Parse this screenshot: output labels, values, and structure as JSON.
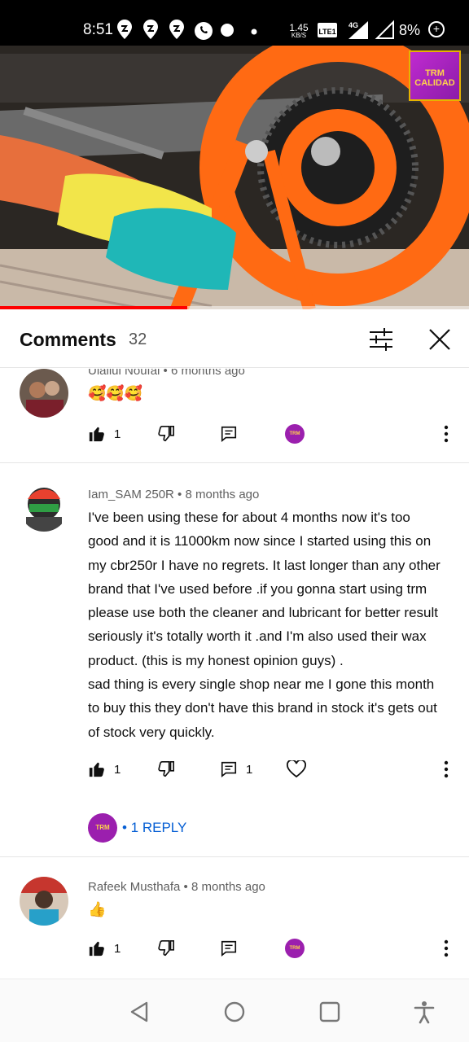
{
  "status_bar": {
    "time": "8:51",
    "speed_value": "1.45",
    "speed_unit": "KB/S",
    "network": "4G",
    "battery": "8%"
  },
  "video": {
    "channel_logo_text": "TRM CALIDAD",
    "progress_fraction": 0.4
  },
  "comments_header": {
    "title": "Comments",
    "count": "32"
  },
  "comments": [
    {
      "author": "Ulallul Noufal",
      "age": "6 months ago",
      "meta": "Ulallul Noufal • 6 months ago",
      "text": "🥰🥰🥰",
      "likes": "1",
      "replies_count": ""
    },
    {
      "author": "Iam_SAM 250R",
      "age": "8 months ago",
      "meta": "Iam_SAM 250R • 8 months ago",
      "text_lines": [
        "I've been using these for about 4 months now it's too",
        "good and it is 11000km now since I started using this on",
        "my cbr250r I have no regrets. It last longer than any other",
        "brand that I've used before .if you gonna start using trm",
        "please use both the cleaner and lubricant for better result",
        "seriously it's totally worth it .and I'm also used their wax",
        "product. (this is my honest opinion guys) .",
        "sad thing is every single shop near me  I gone this month",
        "to buy this they don't have this brand in stock it's gets out",
        "of stock very quickly."
      ],
      "likes": "1",
      "replies_count": "1",
      "reply_link": "• 1 REPLY"
    },
    {
      "author": "Rafeek Musthafa",
      "age": "8 months ago",
      "meta": "Rafeek Musthafa • 8 months ago",
      "text": "👍",
      "likes": "1"
    }
  ],
  "colors": {
    "accent_red": "#ff0000",
    "link_blue": "#065fd4",
    "creator_purple": "#9b1fae"
  }
}
